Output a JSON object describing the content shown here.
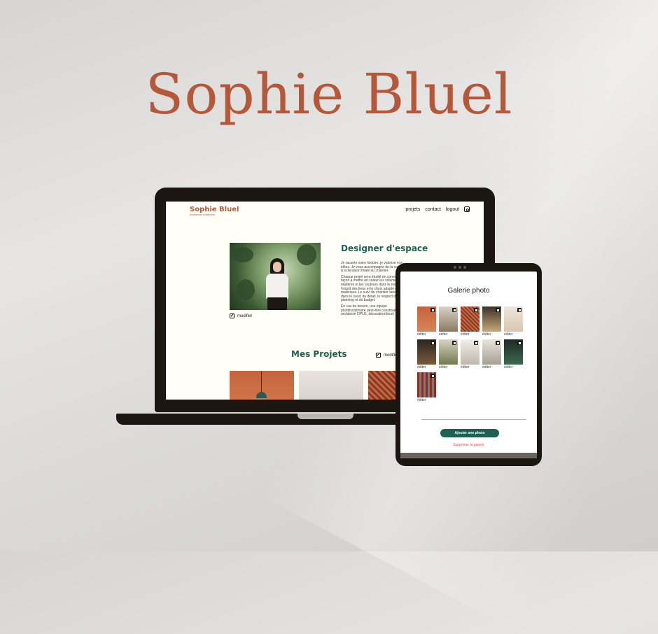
{
  "hero": {
    "title": "Sophie Bluel"
  },
  "site": {
    "logo": "Sophie Bluel",
    "tagline": "Architecte d'intérieur",
    "nav": {
      "projects": "projets",
      "contact": "contact",
      "logout": "logout"
    },
    "about": {
      "edit_label": "modifier",
      "title": "Designer d'espace",
      "paragraphs": [
        "Je raconte votre histoire, je valorise vos idées. Je vous accompagne de la conception à la livraison finale du chantier.",
        "Chaque projet sera étudié en commun, de façon à mettre en valeur les volumes, les matières et les couleurs dans le respect de l'esprit des lieux et le choix adapté des matériaux. Le suivi du chantier sera assuré dans le souci du détail, le respect du planning et du budget.",
        "En cas de besoin, une équipe pluridisciplinaire peut-être constituée : architecte DPLG, décorateur(trice)"
      ]
    },
    "projects": {
      "title": "Mes Projets",
      "edit_label": "modifier"
    }
  },
  "modal": {
    "title": "Galerie photo",
    "item_label": "éditer",
    "add_button": "Ajouter une photo",
    "delete_link": "Supprimer la galerie"
  },
  "colors": {
    "brand": "#b5583a",
    "accent": "#1d6154",
    "danger": "#d65353",
    "background": "#fffef7"
  }
}
